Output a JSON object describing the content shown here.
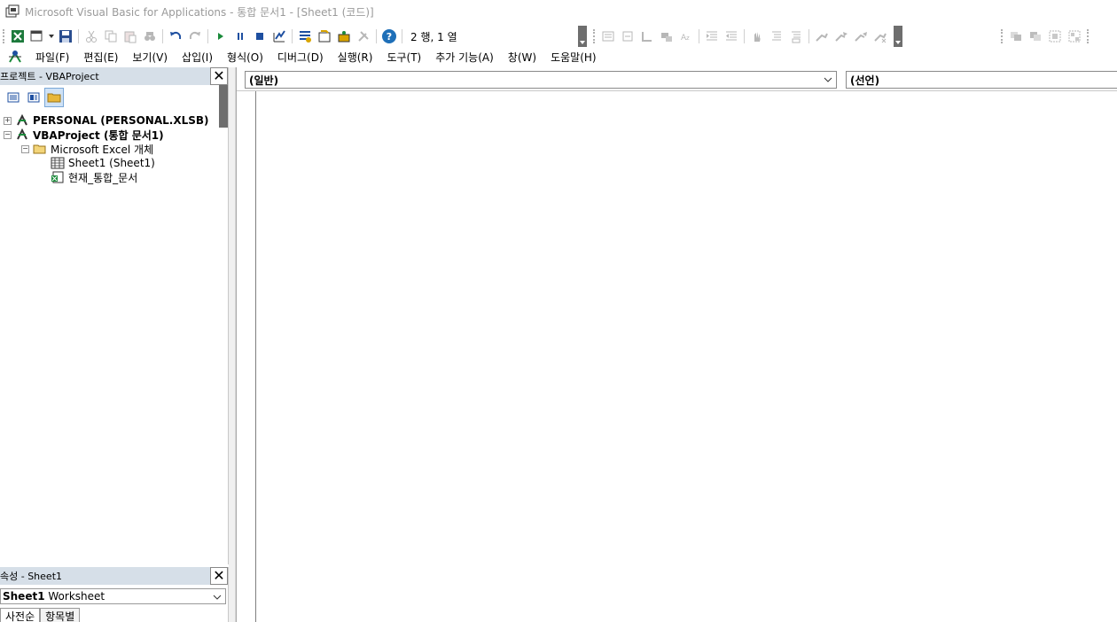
{
  "window": {
    "title": "Microsoft Visual Basic for Applications - 통합 문서1 - [Sheet1 (코드)]"
  },
  "toolbar": {
    "cursor_position": "2 행, 1 열"
  },
  "menu": {
    "items": [
      "파일(F)",
      "편집(E)",
      "보기(V)",
      "삽입(I)",
      "형식(O)",
      "디버그(D)",
      "실행(R)",
      "도구(T)",
      "추가 기능(A)",
      "창(W)",
      "도움말(H)"
    ]
  },
  "project_pane": {
    "title": "프로젝트 - VBAProject",
    "tree": {
      "personal": "PERSONAL (PERSONAL.XLSB)",
      "vbaproject": "VBAProject (통합 문서1)",
      "excel_objects": "Microsoft Excel 개체",
      "sheet1": "Sheet1 (Sheet1)",
      "workbook": "현재_통합_문서"
    }
  },
  "props_pane": {
    "title": "속성 - Sheet1",
    "object_name": "Sheet1",
    "object_type": "Worksheet",
    "tab_alpha": "사전순",
    "tab_category": "항목별"
  },
  "code_window": {
    "object_combo": "(일반)",
    "procedure_combo": "(선언)"
  },
  "colors": {
    "pane_header": "#d6dfe8",
    "accent": "#1e6fb8"
  }
}
